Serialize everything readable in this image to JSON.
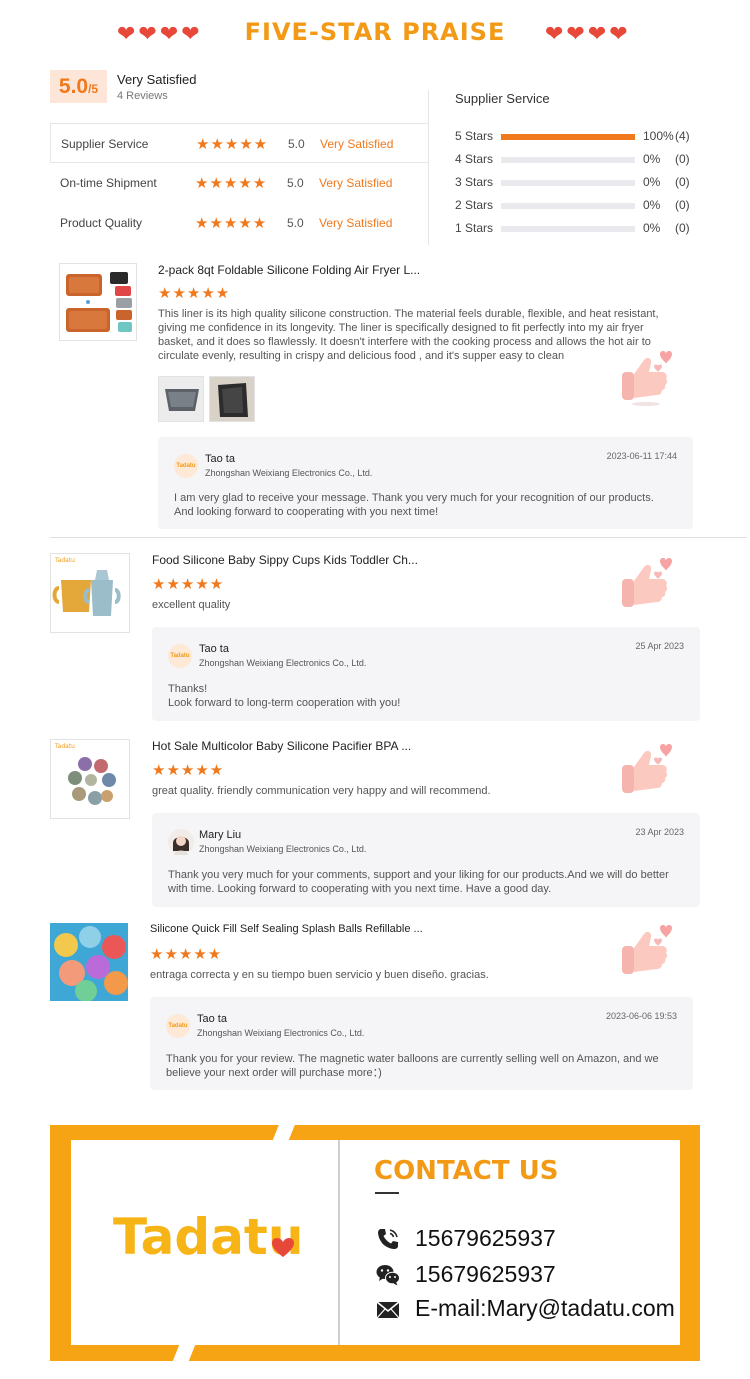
{
  "header": {
    "title": "FIVE-STAR PRAISE",
    "hearts_left": "❤❤❤❤",
    "hearts_right": "❤❤❤❤"
  },
  "summary": {
    "score": "5.0",
    "score_max": "/5",
    "satisfaction": "Very Satisfied",
    "reviews_count": "4 Reviews",
    "metrics": [
      {
        "name": "Supplier Service",
        "stars": "★★★★★",
        "score": "5.0",
        "label": "Very Satisfied"
      },
      {
        "name": "On-time Shipment",
        "stars": "★★★★★",
        "score": "5.0",
        "label": "Very Satisfied"
      },
      {
        "name": "Product Quality",
        "stars": "★★★★★",
        "score": "5.0",
        "label": "Very Satisfied"
      }
    ]
  },
  "distribution": {
    "title": "Supplier Service",
    "rows": [
      {
        "label": "5 Stars",
        "fraction": 1.0,
        "percent": "100%",
        "count": "(4)"
      },
      {
        "label": "4 Stars",
        "fraction": 0.0,
        "percent": "0%",
        "count": "(0)"
      },
      {
        "label": "3 Stars",
        "fraction": 0.0,
        "percent": "0%",
        "count": "(0)"
      },
      {
        "label": "2 Stars",
        "fraction": 0.0,
        "percent": "0%",
        "count": "(0)"
      },
      {
        "label": "1 Stars",
        "fraction": 0.0,
        "percent": "0%",
        "count": "(0)"
      }
    ]
  },
  "reviews": [
    {
      "product": "2-pack 8qt Foldable Silicone Folding Air Fryer L...",
      "stars": "★★★★★",
      "text": "This liner is its high quality silicone construction. The material feels durable, flexible, and heat resistant, giving me confidence in its longevity. The liner is specifically designed to fit perfectly into my air fryer basket, and it does so flawlessly. It doesn't interfere with the cooking process and allows the hot air to circulate evenly, resulting in crispy and delicious food , and it's supper easy to clean",
      "reply": {
        "avatar_text": "Tadatu",
        "name": "Tao ta",
        "company": "Zhongshan Weixiang Electronics Co., Ltd.",
        "date": "2023-06-11 17:44",
        "message": "I am very glad to receive your message. Thank you very much for your recognition of our products. And looking forward to cooperating with you next time!"
      }
    },
    {
      "product": "Food Silicone Baby Sippy Cups Kids Toddler Ch...",
      "stars": "★★★★★",
      "text": "excellent quality",
      "thumb_badge": "Tadatu",
      "reply": {
        "avatar_text": "Tadatu",
        "name": "Tao ta",
        "company": "Zhongshan Weixiang Electronics Co., Ltd.",
        "date": "25 Apr 2023",
        "message": "Thanks!\nLook forward to long-term cooperation with you!"
      }
    },
    {
      "product": "Hot Sale Multicolor Baby Silicone Pacifier BPA ...",
      "stars": "★★★★★",
      "text": "great quality. friendly communication very happy and will recommend.",
      "thumb_badge": "Tadatu",
      "reply": {
        "name": "Mary Liu",
        "company": "Zhongshan Weixiang Electronics Co., Ltd.",
        "date": "23 Apr 2023",
        "message": "Thank you very much for your comments, support and your liking for our products.And we will do better with time. Looking forward to cooperating with you next time. Have a good day."
      }
    },
    {
      "product": "Silicone Quick Fill Self Sealing Splash Balls Refillable ...",
      "stars": "★★★★★",
      "text": "entraga correcta y en su tiempo buen servicio y buen diseño. gracias.",
      "reply": {
        "avatar_text": "Tadatu",
        "name": "Tao ta",
        "company": "Zhongshan Weixiang Electronics Co., Ltd.",
        "date": "2023-06-06 19:53",
        "message": "Thank you for your review. The magnetic water balloons are currently selling well on Amazon, and we believe your next order will purchase more：)"
      }
    }
  ],
  "contact": {
    "logo": "Tadatu",
    "title": "CONTACT US",
    "phone": "15679625937",
    "wechat": "15679625937",
    "email": "E-mail:Mary@tadatu.com"
  },
  "colors": {
    "accent": "#f0791e",
    "title": "#f29a16",
    "frame": "#f6a413",
    "heart": "#e8483a"
  }
}
